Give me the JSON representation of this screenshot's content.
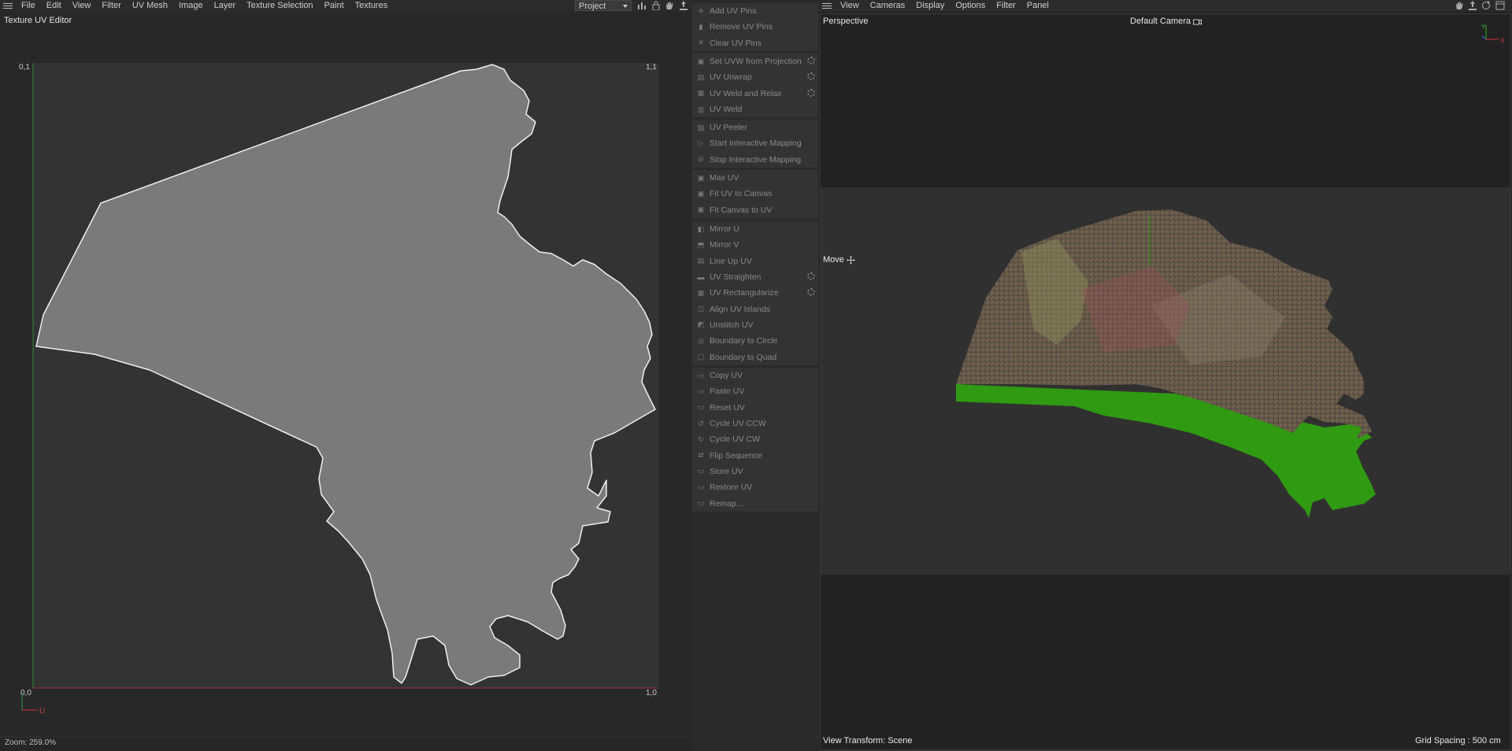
{
  "uv_editor": {
    "menu": [
      "File",
      "Edit",
      "View",
      "Filter",
      "UV Mesh",
      "Image",
      "Layer",
      "Texture Selection",
      "Paint",
      "Textures"
    ],
    "project_select": "Project",
    "title": "Texture UV Editor",
    "corner_labels": {
      "top_left": "0,1",
      "top_right": "1,1",
      "bottom_left": "0,0",
      "bottom_right": "1,0",
      "axis_u": "U"
    },
    "zoom": "Zoom: 259.0%"
  },
  "commands": {
    "groups": [
      [
        {
          "label": "Add UV Pins",
          "icon": "pin-add-icon",
          "gear": false
        },
        {
          "label": "Remove UV Pins",
          "icon": "pin-remove-icon",
          "gear": false
        },
        {
          "label": "Clear UV Pins",
          "icon": "clear-icon",
          "gear": false
        }
      ],
      [
        {
          "label": "Set UVW from Projection",
          "icon": "projection-icon",
          "gear": true
        },
        {
          "label": "UV Unwrap",
          "icon": "unwrap-icon",
          "gear": true
        },
        {
          "label": "UV Weld and Relax",
          "icon": "weld-relax-icon",
          "gear": true
        },
        {
          "label": "UV Weld",
          "icon": "weld-icon",
          "gear": false
        }
      ],
      [
        {
          "label": "UV Peeler",
          "icon": "peeler-icon",
          "gear": false
        },
        {
          "label": "Start Interactive Mapping",
          "icon": "play-icon",
          "gear": false
        },
        {
          "label": "Stop Interactive Mapping",
          "icon": "stop-icon",
          "gear": false
        }
      ],
      [
        {
          "label": "Max UV",
          "icon": "max-uv-icon",
          "gear": false
        },
        {
          "label": "Fit UV to Canvas",
          "icon": "fit-uv-icon",
          "gear": false
        },
        {
          "label": "Fit Canvas to UV",
          "icon": "fit-canvas-icon",
          "gear": false
        }
      ],
      [
        {
          "label": "Mirror U",
          "icon": "mirror-u-icon",
          "gear": false
        },
        {
          "label": "Mirror V",
          "icon": "mirror-v-icon",
          "gear": false
        },
        {
          "label": "Line Up UV",
          "icon": "line-up-icon",
          "gear": false
        },
        {
          "label": "UV Straighten",
          "icon": "straighten-icon",
          "gear": true
        },
        {
          "label": "UV Rectangularize",
          "icon": "rectangularize-icon",
          "gear": true
        },
        {
          "label": "Align UV Islands",
          "icon": "align-icon",
          "gear": false
        },
        {
          "label": "Unstitch UV",
          "icon": "unstitch-icon",
          "gear": false
        },
        {
          "label": "Boundary to Circle",
          "icon": "circle-icon",
          "gear": false
        },
        {
          "label": "Boundary to Quad",
          "icon": "quad-icon",
          "gear": false
        }
      ],
      [
        {
          "label": "Copy UV",
          "icon": "copy-icon",
          "gear": false
        },
        {
          "label": "Paste UV",
          "icon": "paste-icon",
          "gear": false
        },
        {
          "label": "Reset UV",
          "icon": "reset-icon",
          "gear": false
        },
        {
          "label": "Cycle UV CCW",
          "icon": "cycle-ccw-icon",
          "gear": false
        },
        {
          "label": "Cycle UV CW",
          "icon": "cycle-cw-icon",
          "gear": false
        },
        {
          "label": "Flip Sequence",
          "icon": "flip-icon",
          "gear": false
        },
        {
          "label": "Store UV",
          "icon": "store-icon",
          "gear": false
        },
        {
          "label": "Restore UV",
          "icon": "restore-icon",
          "gear": false
        },
        {
          "label": "Remap...",
          "icon": "remap-icon",
          "gear": false
        }
      ]
    ]
  },
  "viewport": {
    "menu": [
      "View",
      "Cameras",
      "Display",
      "Options",
      "Filter",
      "Panel"
    ],
    "projection": "Perspective",
    "camera": "Default Camera",
    "tool": "Move",
    "view_transform": "View Transform: Scene",
    "grid_spacing": "Grid Spacing : 500 cm",
    "axis_labels": {
      "y": "Y",
      "x": "X"
    },
    "colors": {
      "extrusion_side": "#2f9a12",
      "map_top": "#5d5a43"
    }
  }
}
